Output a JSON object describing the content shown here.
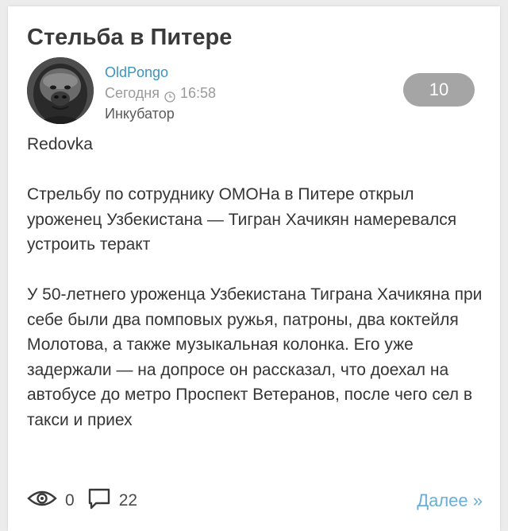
{
  "post": {
    "title": "Стельба в Питере",
    "author": "OldPongo",
    "date": "Сегодня",
    "time": "16:58",
    "blog": "Инкубатор",
    "rating": "10",
    "body": [
      "Redovka",
      "Стрельбу по сотруднику ОМОНа в Питере открыл уроженец Узбекистана — Тигран Хачикян намеревался устроить теракт",
      "У 50-летнего уроженца Узбекистана Тиграна Хачикяна при себе были два помповых ружья, патроны, два коктейля Молотова, а также музыкальная колонка. Его уже задержали — на допросе он рассказал, что доехал на автобусе до метро Проспект Ветеранов, после чего сел в такси и приех"
    ],
    "views": "0",
    "comments": "22",
    "more_label": "Далее »"
  },
  "colors": {
    "author": "#3a94c2",
    "rating_bg": "#a5a5a5",
    "more_link": "#6aaed6"
  }
}
